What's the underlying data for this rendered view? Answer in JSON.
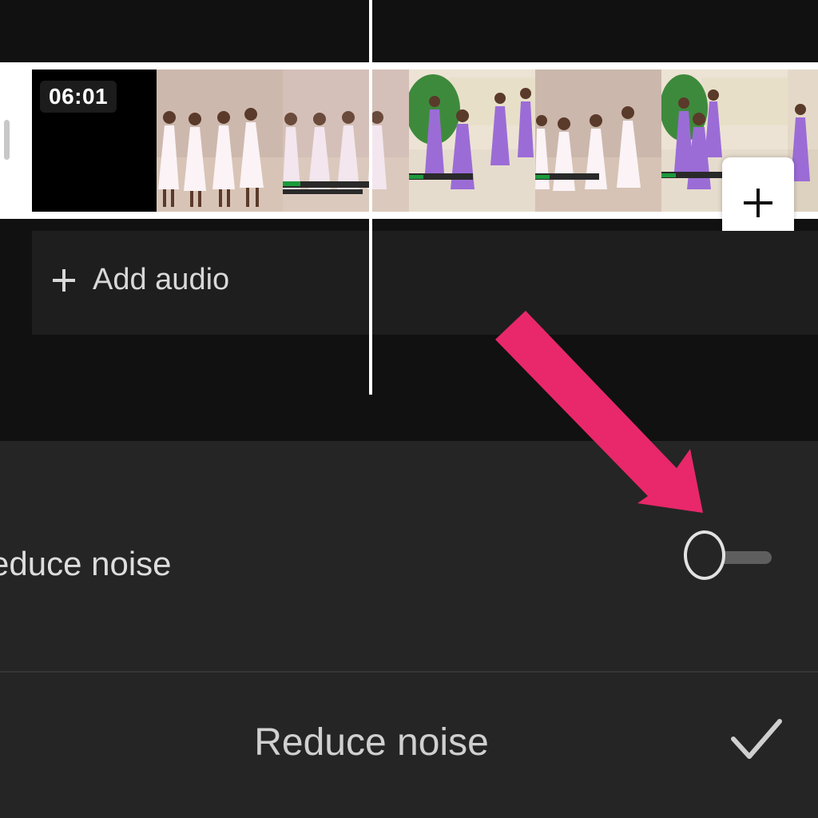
{
  "timeline": {
    "clip_duration": "06:01",
    "add_audio_label": "Add audio"
  },
  "panel": {
    "option_label": "educe noise",
    "toggle_state": "off",
    "title": "Reduce noise"
  },
  "icons": {
    "add_clip": "plus-icon",
    "add_audio": "plus-icon",
    "confirm": "checkmark-icon"
  },
  "colors": {
    "background": "#111111",
    "panel": "#252525",
    "annotation_arrow": "#E8286A",
    "dress_purple": "#9b6cd6"
  }
}
